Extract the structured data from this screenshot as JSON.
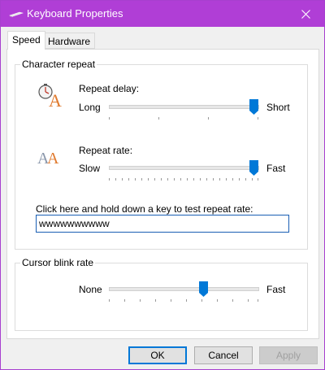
{
  "window": {
    "title": "Keyboard Properties"
  },
  "tabs": [
    {
      "label": "Speed",
      "active": true
    },
    {
      "label": "Hardware",
      "active": false
    }
  ],
  "character_repeat": {
    "group_label": "Character repeat",
    "repeat_delay": {
      "label": "Repeat delay:",
      "min_label": "Long",
      "max_label": "Short",
      "value_fraction": 1.0
    },
    "repeat_rate": {
      "label": "Repeat rate:",
      "min_label": "Slow",
      "max_label": "Fast",
      "value_fraction": 1.0
    },
    "test_prompt": "Click here and hold down a key to test repeat rate:",
    "test_value": "wwwwwwwwww"
  },
  "cursor_blink": {
    "group_label": "Cursor blink rate",
    "min_label": "None",
    "max_label": "Fast",
    "value_fraction": 0.62
  },
  "buttons": {
    "ok": "OK",
    "cancel": "Cancel",
    "apply": "Apply"
  },
  "colors": {
    "titlebar": "#b03ed6",
    "accent": "#0078d7"
  },
  "icons": [
    "keyboard-icon",
    "close-icon",
    "repeat-delay-icon",
    "repeat-rate-icon"
  ]
}
